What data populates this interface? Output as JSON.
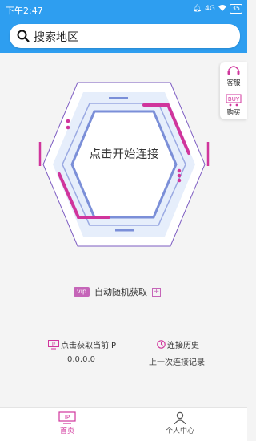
{
  "status": {
    "time": "下午2:47",
    "signal": "4G",
    "battery": "35"
  },
  "header": {
    "search_label": "搜索地区"
  },
  "side": {
    "service": "客服",
    "buy": "购买",
    "buy_icon_text": "BUY"
  },
  "main": {
    "connect_label": "点击开始连接",
    "vip_badge": "vip",
    "auto_label": "自动随机获取",
    "plus": "+",
    "ip_title": "点击获取当前IP",
    "ip_value": "0.0.0.0",
    "history_title": "连接历史",
    "history_sub": "上一次连接记录",
    "ip_icon_text": "IP"
  },
  "tabs": [
    {
      "label": "首页",
      "active": true
    },
    {
      "label": "个人中心",
      "active": false
    }
  ],
  "colors": {
    "accent": "#2e9ef0",
    "pink": "#d0359c",
    "hex_blue": "#7b8fd8",
    "purple": "#7d5cc2"
  }
}
